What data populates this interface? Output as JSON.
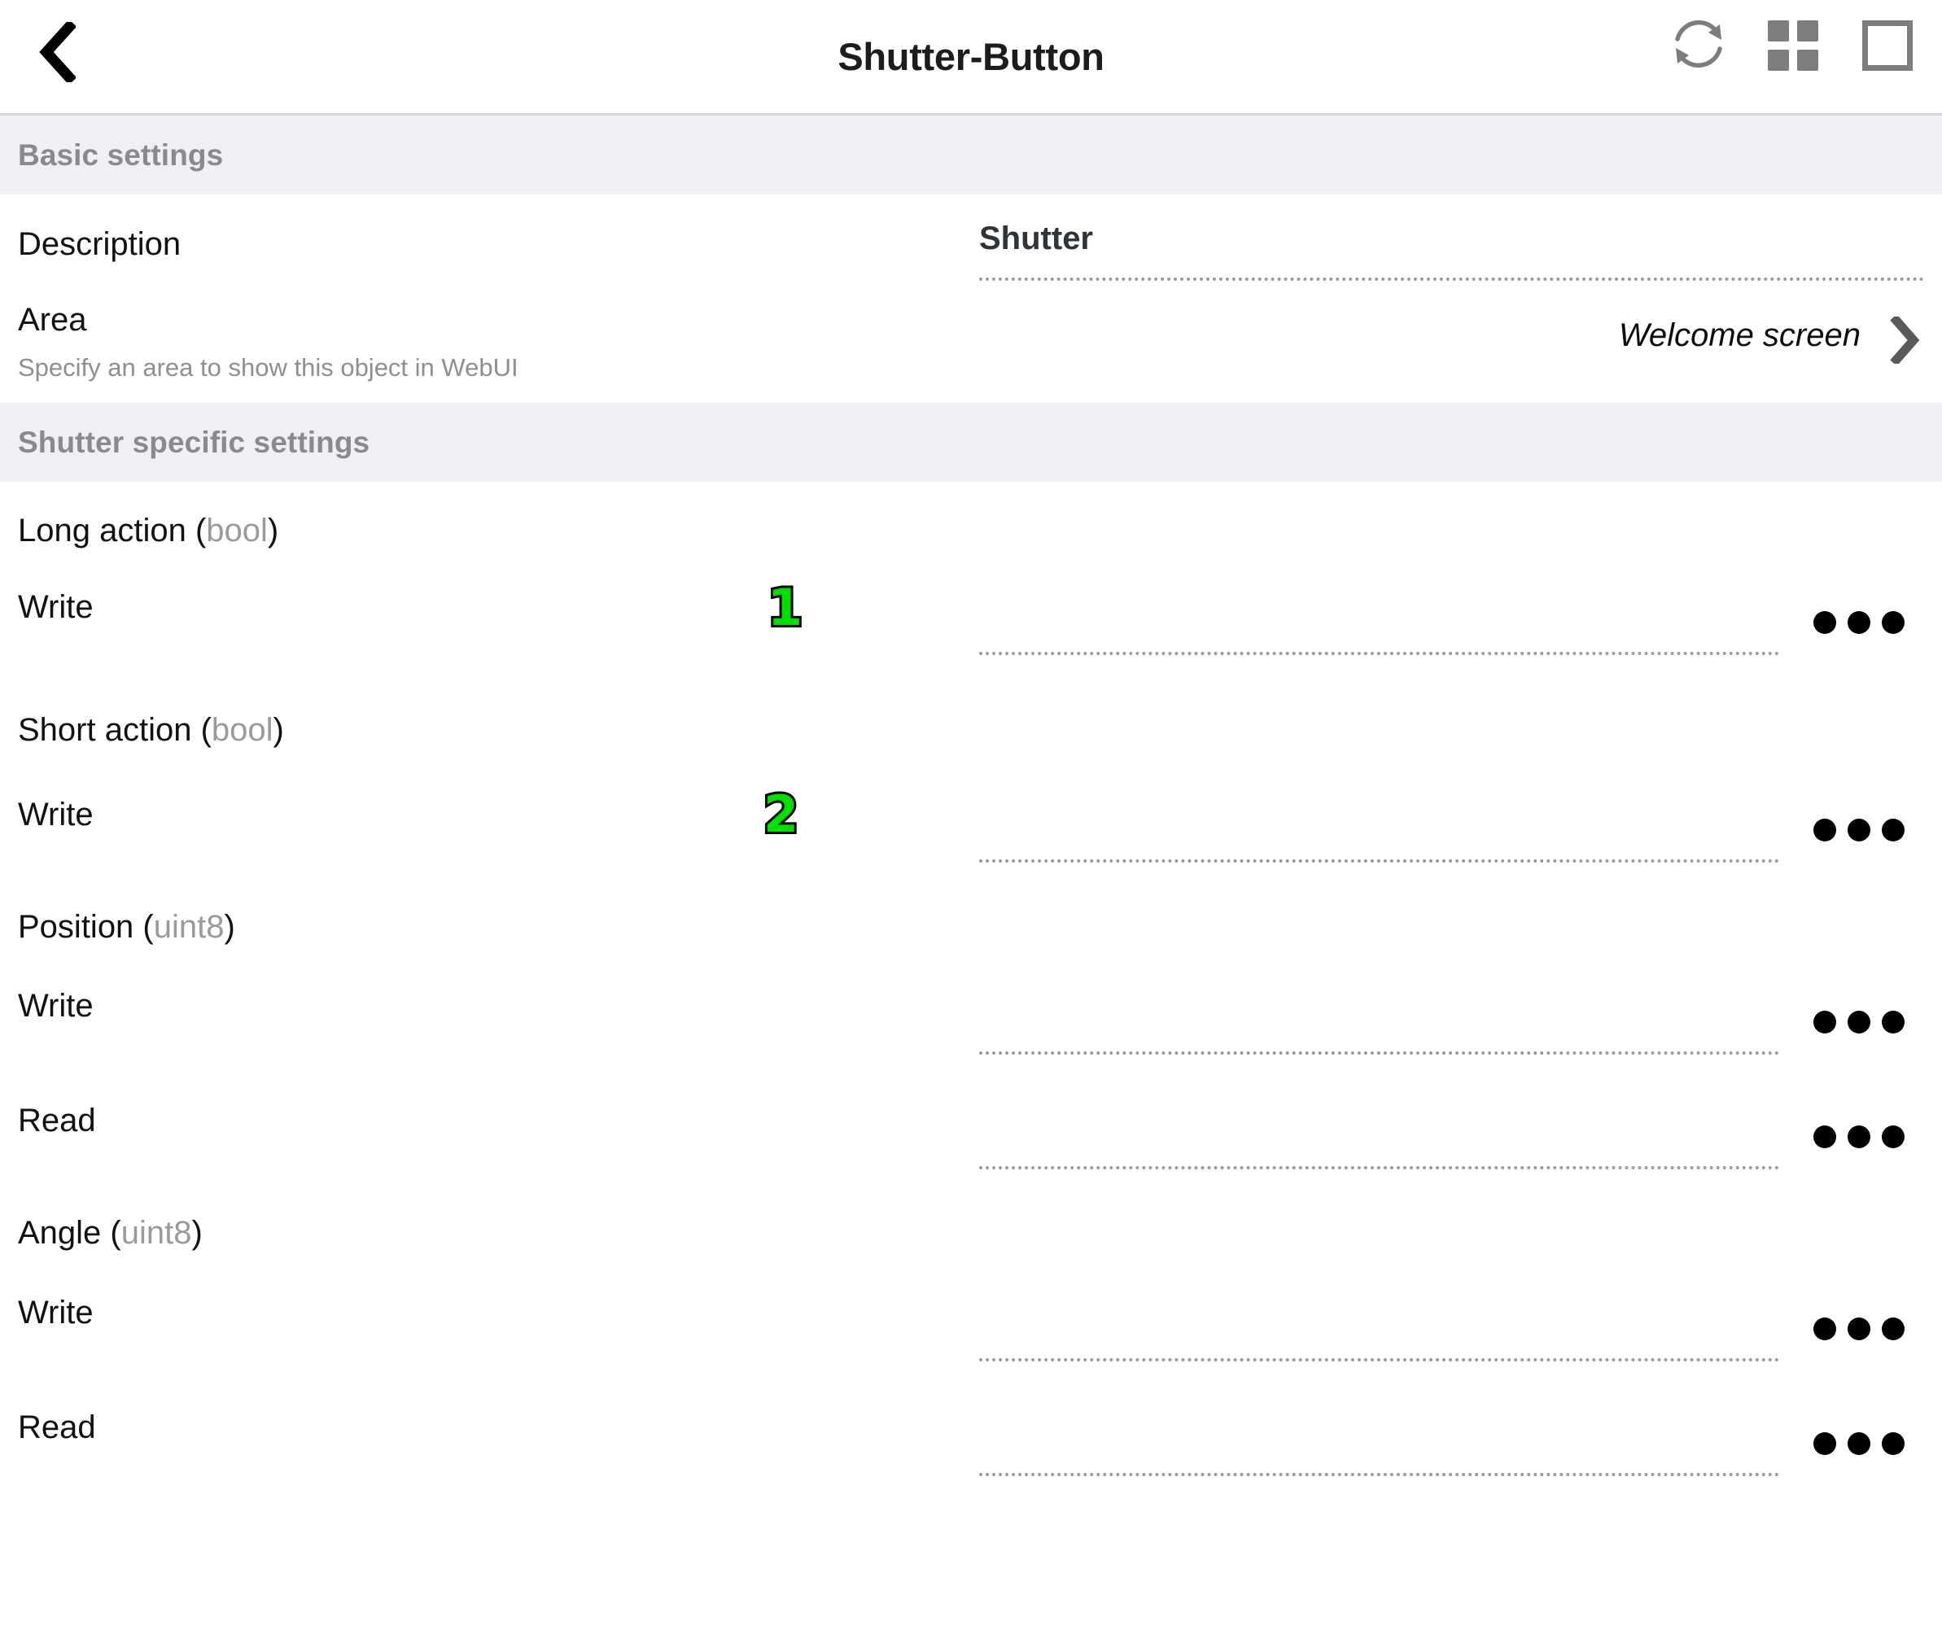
{
  "header": {
    "title": "Shutter-Button",
    "back_icon": "chevron-left-icon",
    "actions": [
      {
        "name": "refresh-icon",
        "label": "Refresh"
      },
      {
        "name": "grid-icon",
        "label": "Grid view"
      },
      {
        "name": "square-icon",
        "label": "Single view"
      }
    ]
  },
  "sections": [
    {
      "id": "basic",
      "title": "Basic settings",
      "rows": [
        {
          "label": "Description",
          "subtitle": "",
          "value": "Shutter",
          "value_style": "bold-dotted"
        },
        {
          "label": "Area",
          "subtitle": "Specify an area to show this object in WebUI",
          "value": "Welcome screen",
          "value_style": "italic-disclosure",
          "chevron": "chevron-right-icon"
        }
      ]
    },
    {
      "id": "shutter_specific",
      "title": "Shutter specific settings",
      "groups": [
        {
          "name": "Long action",
          "type": "bool",
          "entries": [
            {
              "label": "Write",
              "value": "",
              "marker": "1",
              "menu": "ellipsis-menu"
            }
          ]
        },
        {
          "name": "Short action",
          "type": "bool",
          "entries": [
            {
              "label": "Write",
              "value": "",
              "marker": "2",
              "menu": "ellipsis-menu"
            }
          ]
        },
        {
          "name": "Position",
          "type": "uint8",
          "entries": [
            {
              "label": "Write",
              "value": "",
              "marker": "",
              "menu": "ellipsis-menu"
            },
            {
              "label": "Read",
              "value": "",
              "marker": "",
              "menu": "ellipsis-menu"
            }
          ]
        },
        {
          "name": "Angle",
          "type": "uint8",
          "entries": [
            {
              "label": "Write",
              "value": "",
              "marker": "",
              "menu": "ellipsis-menu"
            },
            {
              "label": "Read",
              "value": "",
              "marker": "",
              "menu": "ellipsis-menu"
            }
          ]
        }
      ]
    }
  ],
  "colors": {
    "section_header_bg": "#EFEFF4",
    "section_header_text": "#8A8A8E",
    "marker_green": "#00E000",
    "marker_outline": "#000000",
    "icon_gray": "#7D7D7D",
    "dotted_line": "#9B9B9B"
  }
}
